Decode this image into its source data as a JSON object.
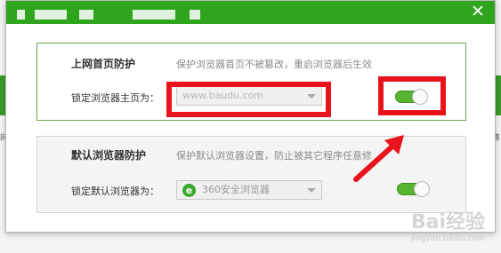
{
  "background": {
    "left_text": "网",
    "right_text": "算"
  },
  "titlebar": {
    "close_glyph": "✕",
    "accent_color": "#2fa51e"
  },
  "homepage_protection": {
    "heading": "上网首页防护",
    "description": "保护浏览器首页不被篡改，重启浏览器后生效",
    "lock_label": "锁定浏览器主页为：",
    "homepage_value": "www.baudu.com",
    "toggle_state": "on"
  },
  "default_browser_protection": {
    "heading": "默认浏览器防护",
    "description": "保护默认浏览器设置，防止被其它程序任意修",
    "lock_label": "锁定默认浏览器为：",
    "browser_value": "360安全浏览器",
    "toggle_state": "on"
  },
  "watermark": {
    "text": "Bai经验",
    "sub": "jingyan.baidu.com"
  },
  "highlight_color": "#e8131b"
}
